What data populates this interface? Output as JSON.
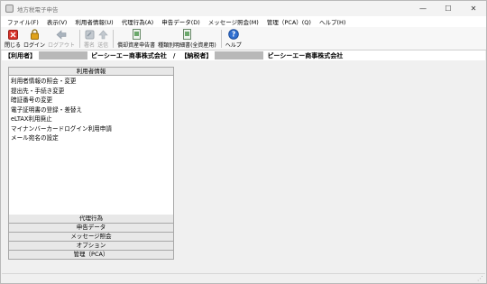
{
  "window": {
    "title": "地方税電子申告",
    "minimize_glyph": "—",
    "maximize_glyph": "☐",
    "close_glyph": "✕"
  },
  "menu": [
    "ファイル(F)",
    "表示(V)",
    "利用者情報(U)",
    "代理行為(A)",
    "申告データ(D)",
    "メッセージ照会(M)",
    "管理（PCA）(Q)",
    "ヘルプ(H)"
  ],
  "toolbar": {
    "close": {
      "label": "閉じる",
      "icon": "close-icon"
    },
    "login": {
      "label": "ログイン",
      "icon": "lock-icon"
    },
    "logout": {
      "label": "ログアウト",
      "icon": "back-arrow-icon"
    },
    "sign": {
      "label": "署名",
      "icon": "sign-icon"
    },
    "send": {
      "label": "送信",
      "icon": "send-icon"
    },
    "depreciation": {
      "label": "償却資産申告書",
      "icon": "document-icon"
    },
    "breakdown": {
      "label": "種類別明細書(全資産用)",
      "icon": "document-icon"
    },
    "help": {
      "label": "ヘルプ",
      "icon": "help-icon"
    }
  },
  "userbar": {
    "user_label": "【利用者】",
    "user_name": "ピーシーエー商事株式会社",
    "separator": "/",
    "taxpayer_label": "【納税者】",
    "taxpayer_name": "ピーシーエー商事株式会社"
  },
  "nav": {
    "user_info_header": "利用者情報",
    "user_info_items": [
      "利用者情報の照会・変更",
      "提出先・手続き変更",
      "暗証番号の変更",
      "電子証明書の登録・差替え",
      "eLTAX利用廃止",
      "マイナンバーカードログイン利用申請",
      "メール宛名の設定"
    ],
    "collapsed_sections": [
      "代理行為",
      "申告データ",
      "メッセージ照会",
      "オプション",
      "管理（PCA）"
    ]
  },
  "colors": {
    "close_red": "#d9342b",
    "lock_gold": "#e0a21a",
    "help_blue": "#2f6fd1",
    "disabled_gray": "#a9b3bd",
    "doc_green": "#6aa86a"
  }
}
